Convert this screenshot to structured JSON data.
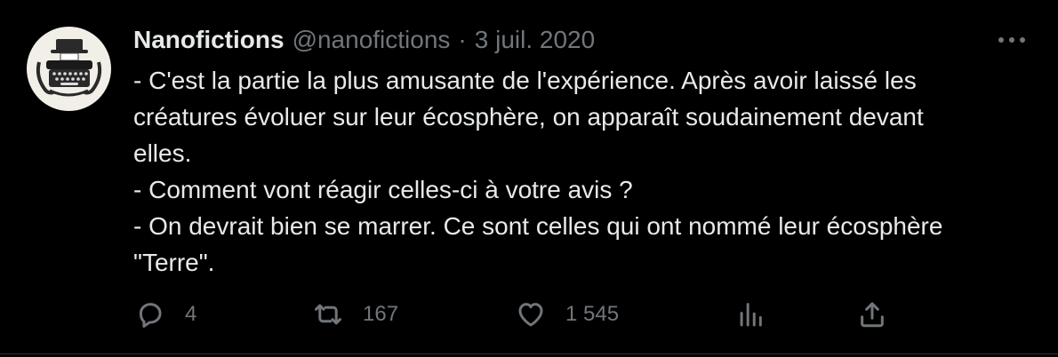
{
  "author": {
    "display_name": "Nanofictions",
    "handle": "@nanofictions",
    "separator": "·",
    "timestamp": "3 juil. 2020",
    "avatar_icon": "typewriter-avatar"
  },
  "more_icon": "more-dots-icon",
  "body_lines": [
    "- C'est la partie la plus amusante de l'expérience. Après avoir laissé les",
    "créatures évoluer sur leur écosphère, on apparaît soudainement devant",
    "elles.",
    "- Comment vont réagir celles-ci à votre avis ?",
    "- On devrait bien se marrer. Ce sont celles qui ont nommé leur écosphère",
    "\"Terre\"."
  ],
  "actions": {
    "reply": {
      "icon": "reply-icon",
      "count": "4"
    },
    "retweet": {
      "icon": "retweet-icon",
      "count": "167"
    },
    "like": {
      "icon": "heart-icon",
      "count": "1 545"
    },
    "views": {
      "icon": "analytics-icon"
    },
    "share": {
      "icon": "share-icon"
    }
  },
  "colors": {
    "background": "#000000",
    "primary_text": "#e7e9ea",
    "secondary_text": "#71767b"
  }
}
